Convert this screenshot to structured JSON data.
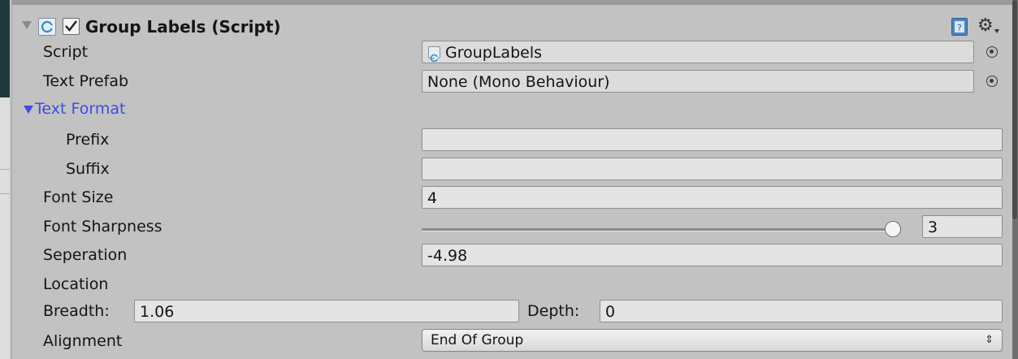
{
  "component": {
    "title": "Group Labels (Script)",
    "enabled": true
  },
  "fields": {
    "script": {
      "label": "Script",
      "value": "GroupLabels"
    },
    "text_prefab": {
      "label": "Text Prefab",
      "value": "None (Mono Behaviour)"
    },
    "text_format": {
      "label": "Text Format",
      "prefix": {
        "label": "Prefix",
        "value": ""
      },
      "suffix": {
        "label": "Suffix",
        "value": ""
      }
    },
    "font_size": {
      "label": "Font Size",
      "value": "4"
    },
    "font_sharpness": {
      "label": "Font Sharpness",
      "value": "3",
      "slider_fraction": 1.0
    },
    "seperation": {
      "label": "Seperation",
      "value": "-4.98"
    },
    "location": {
      "label": "Location",
      "breadth_label": "Breadth:",
      "breadth_value": "1.06",
      "depth_label": "Depth:",
      "depth_value": "0"
    },
    "alignment": {
      "label": "Alignment",
      "value": "End Of Group",
      "arrows": "⇕"
    }
  },
  "icons": {
    "foldout": "foldout-arrow-icon",
    "script": "csharp-script-icon",
    "checkbox": "enabled-checkbox-icon",
    "help": "help-book-icon",
    "settings": "gear-icon",
    "picker": "object-picker-icon"
  }
}
